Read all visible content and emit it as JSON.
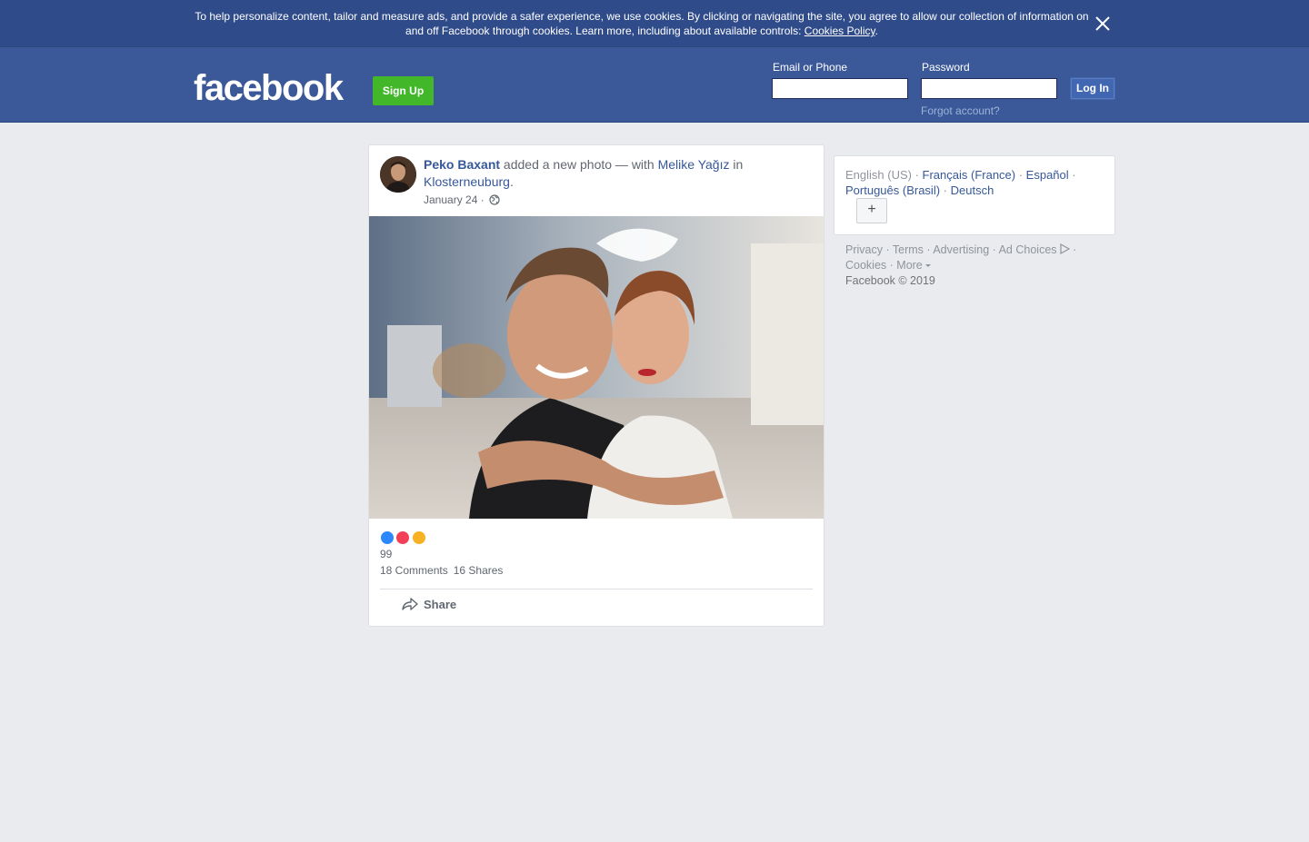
{
  "cookie_banner": {
    "text": "To help personalize content, tailor and measure ads, and provide a safer experience, we use cookies. By clicking or navigating the site, you agree to allow our collection of information on and off Facebook through cookies. Learn more, including about available controls: ",
    "policy_link": "Cookies Policy",
    "period": "."
  },
  "header": {
    "logo": "facebook",
    "signup_label": "Sign Up",
    "email_label": "Email or Phone",
    "password_label": "Password",
    "email_value": "",
    "password_value": "",
    "login_label": "Log In",
    "forgot_label": "Forgot account?"
  },
  "post": {
    "author": "Peko Baxant",
    "action": " added a new photo — with ",
    "tagged": "Melike Yağız",
    "in_text": " in ",
    "location": "Klosterneuburg",
    "location_end": ".",
    "date": "January 24",
    "date_sep": " · ",
    "reaction_count": "99",
    "comments": "18 Comments",
    "shares": "16 Shares",
    "share_label": "Share"
  },
  "languages": {
    "current": "English (US)",
    "items": [
      "Français (France)",
      "Español",
      "Português (Brasil)",
      "Deutsch"
    ],
    "sep": " · ",
    "add_label": "+"
  },
  "footer": {
    "privacy": "Privacy",
    "terms": "Terms",
    "advertising": "Advertising",
    "ad_choices": "Ad Choices",
    "cookies": "Cookies",
    "more": "More",
    "sep": " · ",
    "copyright": "Facebook © 2019"
  },
  "colors": {
    "brand_blue": "#3b5998",
    "banner_blue": "#2f4b89",
    "signup_green": "#42b72a",
    "link_blue": "#365899"
  }
}
